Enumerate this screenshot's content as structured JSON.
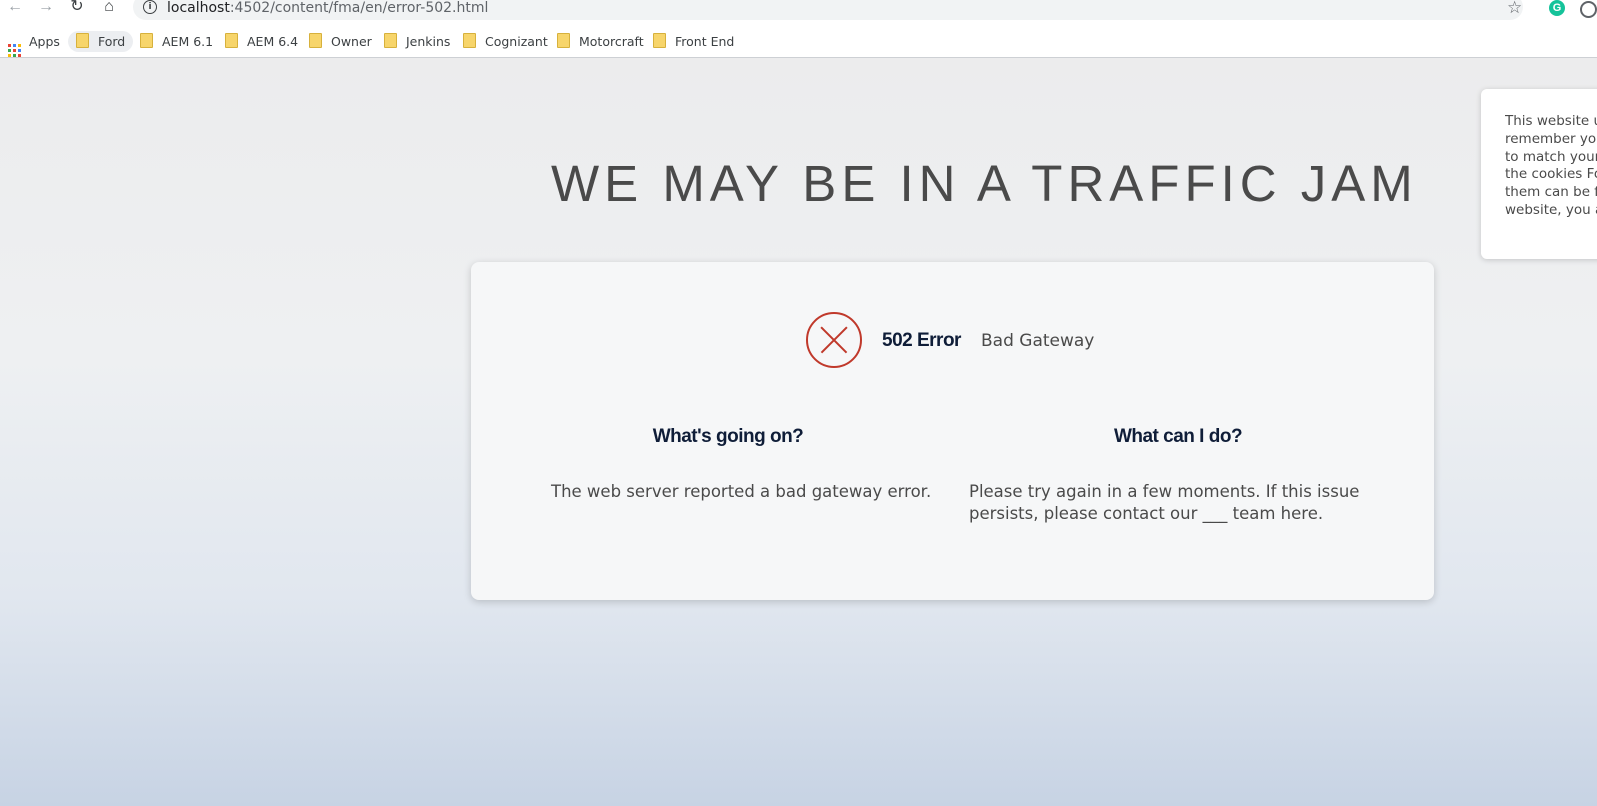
{
  "browser": {
    "url_host": "localhost",
    "url_rest": ":4502/content/fma/en/error-502.html",
    "bookmarks": [
      {
        "label": "Apps",
        "icon": "apps-grid-icon"
      },
      {
        "label": "Ford",
        "icon": "folder-icon"
      },
      {
        "label": "AEM 6.1",
        "icon": "folder-icon"
      },
      {
        "label": "AEM 6.4",
        "icon": "folder-icon"
      },
      {
        "label": "Owner",
        "icon": "folder-icon"
      },
      {
        "label": "Jenkins",
        "icon": "folder-icon"
      },
      {
        "label": "Cognizant",
        "icon": "folder-icon"
      },
      {
        "label": "Motorcraft",
        "icon": "folder-icon"
      },
      {
        "label": "Front End",
        "icon": "folder-icon"
      }
    ],
    "extension_letter": "G"
  },
  "page": {
    "headline": "WE MAY BE IN A TRAFFIC JAM",
    "error": {
      "code": "502 Error",
      "description": "Bad Gateway",
      "icon": "error-x-circle-icon",
      "color": "#c0392b"
    },
    "left_column": {
      "heading": "What's going on?",
      "text": "The web server reported a bad gateway error."
    },
    "right_column": {
      "heading": "What can I do?",
      "line1": "Please try again in a few moments. If this issue",
      "line2": "persists, please contact our ___ team here."
    },
    "cookie_banner": {
      "lines": "This website us\nremember your\nto match your p\nthe cookies For\nthem can be fo\nwebsite, you ag"
    }
  }
}
